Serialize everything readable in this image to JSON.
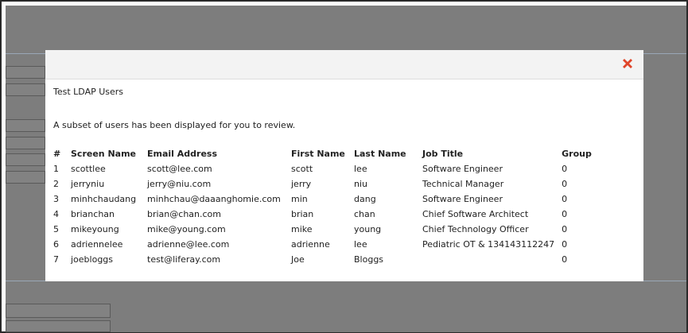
{
  "dialog": {
    "title": "Test LDAP Users",
    "message": "A subset of users has been displayed for you to review.",
    "close_icon": "close-icon",
    "close_color": "#e0452a"
  },
  "table": {
    "headers": [
      "#",
      "Screen Name",
      "Email Address",
      "First Name",
      "Last Name",
      "Job Title",
      "Group"
    ],
    "rows": [
      [
        "1",
        "scottlee",
        "scott@lee.com",
        "scott",
        "lee",
        "Software Engineer",
        "0"
      ],
      [
        "2",
        "jerryniu",
        "jerry@niu.com",
        "jerry",
        "niu",
        "Technical Manager",
        "0"
      ],
      [
        "3",
        "minhchaudang",
        "minhchau@daaanghomie.com",
        "min",
        "dang",
        "Software Engineer",
        "0"
      ],
      [
        "4",
        "brianchan",
        "brian@chan.com",
        "brian",
        "chan",
        "Chief Software Architect",
        "0"
      ],
      [
        "5",
        "mikeyoung",
        "mike@young.com",
        "mike",
        "young",
        "Chief Technology Officer",
        "0"
      ],
      [
        "6",
        "adriennelee",
        "adrienne@lee.com",
        "adrienne",
        "lee",
        "Pediatric OT & 134143112247",
        "0"
      ],
      [
        "7",
        "joebloggs",
        "test@liferay.com",
        "Joe",
        "Bloggs",
        "",
        "0"
      ]
    ]
  }
}
